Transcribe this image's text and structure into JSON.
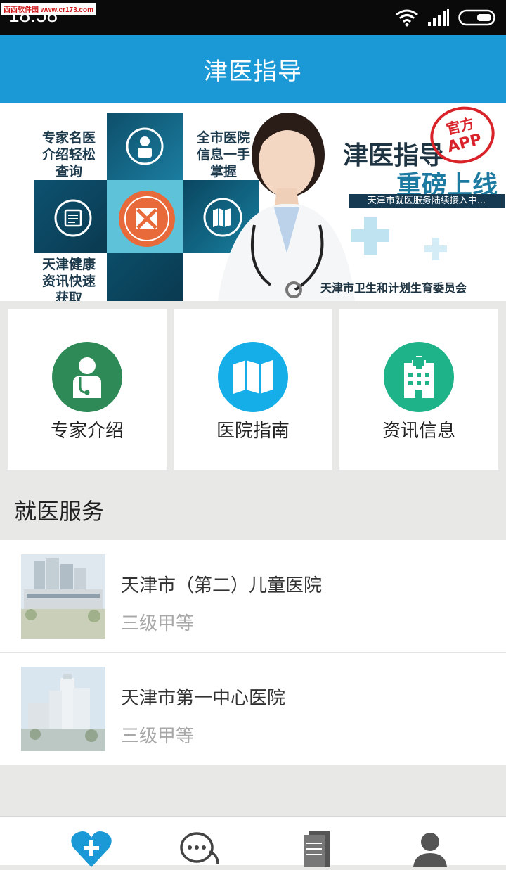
{
  "status_bar": {
    "time": "18:58",
    "watermark": "西西软件园 www.cr173.com"
  },
  "header": {
    "title": "津医指导"
  },
  "banner": {
    "tile_top_left": "专家名医\n介绍轻松\n查询",
    "tile_top_right": "全市医院\n信息一手\n掌握",
    "tile_bottom_left": "天津健康\n资讯快速\n获取",
    "app_name": "津医指导",
    "headline": "重磅上线",
    "stamp_line1": "官方",
    "stamp_line2": "APP",
    "ribbon": "天津市就医服务陆续接入中...",
    "footer_org": "天津市卫生和计划生育委员会"
  },
  "quick_cards": [
    {
      "label": "专家介绍",
      "icon": "doctor-icon",
      "color": "#2e8b57"
    },
    {
      "label": "医院指南",
      "icon": "map-icon",
      "color": "#16aee8"
    },
    {
      "label": "资讯信息",
      "icon": "hospital-building-icon",
      "color": "#1fb38a"
    }
  ],
  "services": {
    "heading": "就医服务",
    "hospitals": [
      {
        "name": "天津市（第二）儿童医院",
        "grade": "三级甲等"
      },
      {
        "name": "天津市第一中心医院",
        "grade": "三级甲等"
      }
    ]
  },
  "tabs": [
    {
      "icon": "medical-cross-heart-icon",
      "active": true
    },
    {
      "icon": "chat-bubble-icon",
      "active": false
    },
    {
      "icon": "documents-icon",
      "active": false
    },
    {
      "icon": "user-icon",
      "active": false
    }
  ],
  "colors": {
    "primary": "#1a99d6",
    "background": "#e8e8e6"
  }
}
